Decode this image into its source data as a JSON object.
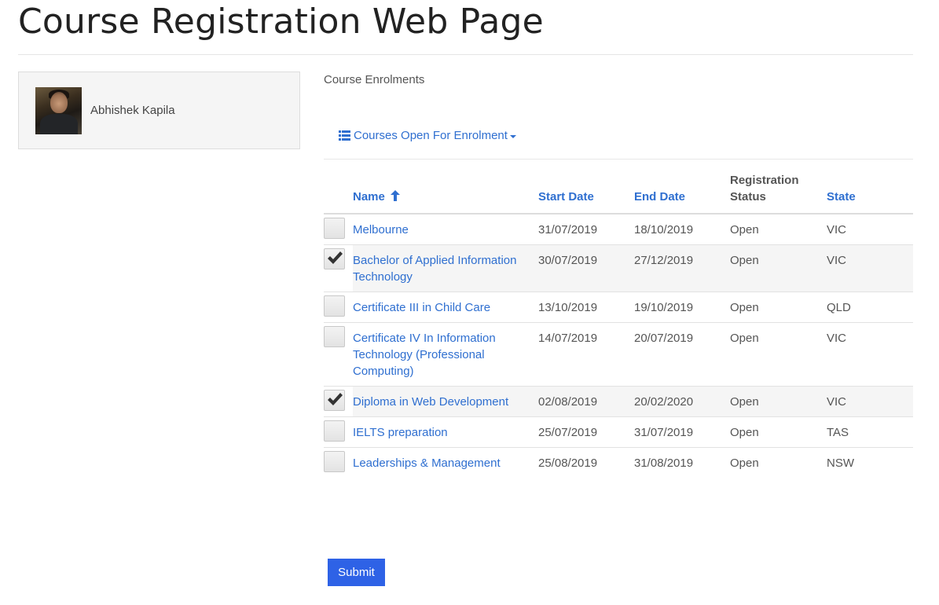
{
  "page": {
    "title": "Course Registration Web Page"
  },
  "profile": {
    "name": "Abhishek Kapila"
  },
  "section": {
    "label": "Course Enrolments"
  },
  "dropdown": {
    "label": "Courses Open For Enrolment"
  },
  "table": {
    "headers": {
      "name": "Name",
      "start_date": "Start Date",
      "end_date": "End Date",
      "status_line1": "Registration",
      "status_line2": "Status",
      "state": "State"
    },
    "sort": {
      "column": "Name",
      "direction": "ascending"
    },
    "rows": [
      {
        "checked": false,
        "name": "Melbourne",
        "start": "31/07/2019",
        "end": "18/10/2019",
        "status": "Open",
        "state": "VIC"
      },
      {
        "checked": true,
        "name": "Bachelor of Applied Information Technology",
        "start": "30/07/2019",
        "end": "27/12/2019",
        "status": "Open",
        "state": "VIC"
      },
      {
        "checked": false,
        "name": "Certificate III in Child Care",
        "start": "13/10/2019",
        "end": "19/10/2019",
        "status": "Open",
        "state": "QLD"
      },
      {
        "checked": false,
        "name": "Certificate IV In Information Technology (Professional Computing)",
        "start": "14/07/2019",
        "end": "20/07/2019",
        "status": "Open",
        "state": "VIC"
      },
      {
        "checked": true,
        "name": "Diploma in Web Development",
        "start": "02/08/2019",
        "end": "20/02/2020",
        "status": "Open",
        "state": "VIC"
      },
      {
        "checked": false,
        "name": "IELTS preparation",
        "start": "25/07/2019",
        "end": "31/07/2019",
        "status": "Open",
        "state": "TAS"
      },
      {
        "checked": false,
        "name": "Leaderships & Management",
        "start": "25/08/2019",
        "end": "31/08/2019",
        "status": "Open",
        "state": "NSW"
      }
    ]
  },
  "actions": {
    "submit_label": "Submit"
  },
  "colors": {
    "link": "#2f6fd0",
    "button": "#2e62e6",
    "panel": "#f5f5f5"
  },
  "icons": {
    "list": "list-icon",
    "sort": "arrow-up-icon",
    "check": "check-icon"
  }
}
